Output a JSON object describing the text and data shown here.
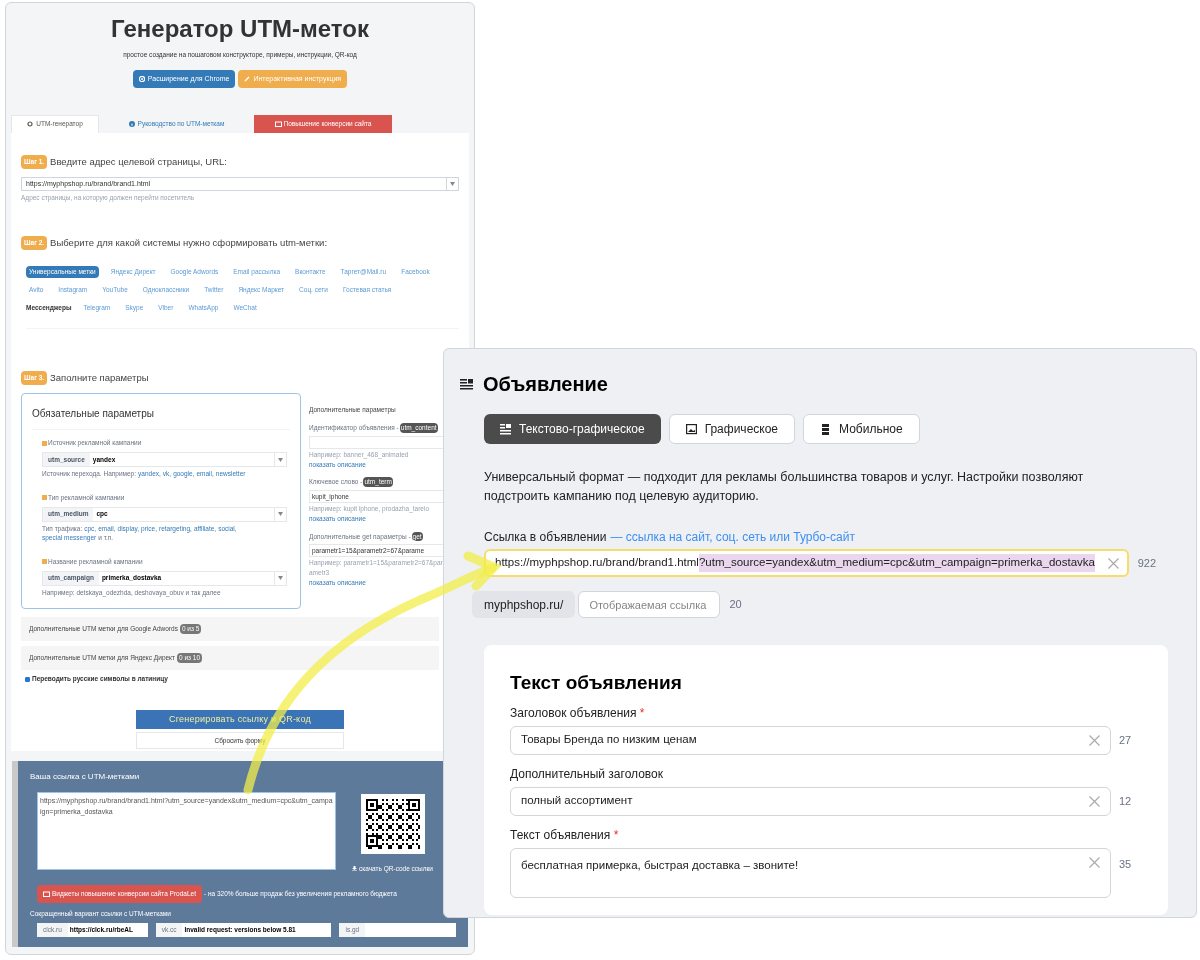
{
  "utm_page": {
    "title": "Генератор UTM-меток",
    "subtitle": "простое создание на пошаговом конструкторе, примеры, инструкции, QR-код",
    "header_buttons": [
      {
        "label": "Расширение для Chrome",
        "kind": "chrome"
      },
      {
        "label": "Интерактивная инструкция",
        "kind": "guide"
      }
    ],
    "tabs": [
      {
        "label": "UTM-генератор",
        "selected": true,
        "kind": "generator"
      },
      {
        "label": "Руководство по UTM-меткам",
        "selected": false,
        "kind": "guide"
      },
      {
        "label": "Повышение конверсии сайта",
        "selected": false,
        "kind": "promo"
      }
    ],
    "step1": {
      "badge": "Шаг 1.",
      "title": "Введите адрес целевой страницы, URL:",
      "value": "https://myphpshop.ru/brand/brand1.html",
      "hint": "Адрес страницы, на которую должен перейти посетитель"
    },
    "step2": {
      "badge": "Шаг 2.",
      "title": "Выберите для какой системы нужно сформировать utm-метки:",
      "rows": [
        {
          "systems": [
            {
              "label": "Универсальные метки",
              "kind": "system",
              "selected": true
            },
            {
              "label": "Яндекс Директ",
              "kind": "system",
              "selected": false
            },
            {
              "label": "Google Adwords",
              "kind": "system",
              "selected": false
            },
            {
              "label": "Email рассылка",
              "kind": "system",
              "selected": false
            },
            {
              "label": "Вконтакте",
              "kind": "system",
              "selected": false
            },
            {
              "label": "Таргет@Mail.ru",
              "kind": "system",
              "selected": false
            },
            {
              "label": "Facebook",
              "kind": "system",
              "selected": false
            }
          ]
        },
        {
          "systems": [
            {
              "label": "Avito",
              "kind": "system",
              "selected": false
            },
            {
              "label": "Instagram",
              "kind": "system",
              "selected": false
            },
            {
              "label": "YouTube",
              "kind": "system",
              "selected": false
            },
            {
              "label": "Одноклассники",
              "kind": "system",
              "selected": false
            },
            {
              "label": "Twitter",
              "kind": "system",
              "selected": false
            },
            {
              "label": "Яндекс Маркет",
              "kind": "system",
              "selected": false
            },
            {
              "label": "Соц. сети",
              "kind": "system",
              "selected": false
            },
            {
              "label": "Гостевая статья",
              "kind": "system",
              "selected": false
            }
          ]
        },
        {
          "label": "Мессенджеры",
          "systems": [
            {
              "label": "Telegram",
              "kind": "system",
              "selected": false
            },
            {
              "label": "Skype",
              "kind": "system",
              "selected": false
            },
            {
              "label": "Viber",
              "kind": "system",
              "selected": false
            },
            {
              "label": "WhatsApp",
              "kind": "system",
              "selected": false
            },
            {
              "label": "WeChat",
              "kind": "system",
              "selected": false
            }
          ]
        }
      ]
    },
    "step3": {
      "badge": "Шаг 3.",
      "title": "Заполните параметры",
      "required": {
        "title": "Обязательные параметры",
        "fields": [
          {
            "label": "Источник рекламной кампании",
            "addon": "utm_source",
            "value": "yandex",
            "help": "Источник перехода. Например:",
            "examples": [
              "yandex,",
              "vk,",
              "google,",
              "email,",
              "newsletter"
            ]
          },
          {
            "label": "Тип рекламной кампании",
            "addon": "utm_medium",
            "value": "cpc",
            "help": "Тип трафика:",
            "examples": [
              "cpc,",
              "email,",
              "display,",
              "price,",
              "retargeting,",
              "affiliate,",
              "social,",
              "special messenger"
            ],
            "suffix": "и т.п."
          },
          {
            "label": "Название рекламной кампании",
            "addon": "utm_campaign",
            "value": "primerka_dostavka",
            "help": "Например: detskaya_odezhda, deshovaya_obuv и так далее"
          }
        ]
      },
      "optional": {
        "title": "Дополнительные параметры",
        "fields": [
          {
            "label": "Идентификатор объявления -",
            "tag": "utm_content",
            "help": "Например: banner_468_animated",
            "link": "показать описание"
          },
          {
            "label": "Ключевое слово -",
            "tag": "utm_term",
            "value": "kupit_iphone",
            "help": "Например: kupit iphone, prodazha_tareio",
            "link": "показать описание"
          },
          {
            "label": "Дополнительные get параметры -",
            "tag": "get",
            "value": "parametr1=15&parametr2=67&parame",
            "help": "Например: parametr1=15&parametr2=67&parametr3",
            "link": "показать описание"
          }
        ]
      }
    },
    "accordions": [
      {
        "title": "Дополнительные UTM метки для Google Adwords",
        "count": "0 из 5"
      },
      {
        "title": "Дополнительные UTM метки для Яндекс Директ",
        "count": "0 из 10"
      }
    ],
    "transliterate": {
      "label": "Переводить русские символы в латиницу",
      "checked": true
    },
    "generate_button": "Сгенерировать ссылку и QR-код",
    "reset_button": "Сбросить форму",
    "result": {
      "title": "Ваша ссылка с UTM-метками",
      "link": "https://myphpshop.ru/brand/brand1.html?utm_source=yandex&utm_medium=cpc&utm_campaign=primerka_dostavka",
      "qr_download": "скачать QR-code ссылки",
      "promo_button": "Виджеты повышение конверсии сайта ProdaLet",
      "promo_text": "- на 320% больше продаж без увеличения рекламного бюджета",
      "short_title": "Сокращенный вариант ссылки с UTM-метками",
      "shorteners": [
        {
          "service": "clck.ru",
          "value": "https://clck.ru/rbeAL"
        },
        {
          "service": "vk.cc",
          "value": "Invalid request: versions below 5.81"
        },
        {
          "service": "is.gd"
        }
      ]
    }
  },
  "ad_panel": {
    "title": "Объявление",
    "formats": [
      {
        "label": "Текстово-графическое",
        "selected": true,
        "kind": "text-image"
      },
      {
        "label": "Графическое",
        "selected": false,
        "kind": "image"
      },
      {
        "label": "Мобильное",
        "selected": false,
        "kind": "mobile"
      }
    ],
    "description": "Универсальный формат — подходит для рекламы большинства товаров и услуг. Настройки позволяют подстроить кампанию под целевую аудиторию.",
    "link_label": "Ссылка в объявлении",
    "link_hint": "— ссылка на сайт, соц. сеть или Турбо-сайт",
    "link_value": "https://myphpshop.ru/brand/brand1.html",
    "link_selected": "?utm_source=yandex&utm_medium=cpc&utm_campaign=primerka_dostavka",
    "link_count": "922",
    "display_domain": "myphpshop.ru/",
    "display_placeholder": "Отображаемая ссылка",
    "display_count": "20",
    "text_section": {
      "title": "Текст объявления",
      "fields": [
        {
          "label": "Заголовок объявления",
          "asterisk": "*",
          "value": "Товары Бренда по низким ценам",
          "count": "27",
          "kind": "input"
        },
        {
          "label": "Дополнительный заголовок",
          "value": "полный ассортимент",
          "count": "12",
          "kind": "input"
        },
        {
          "label": "Текст объявления",
          "asterisk": "*",
          "value": "бесплатная примерка, быстрая доставка – звоните!",
          "count": "35",
          "kind": "textarea"
        }
      ]
    }
  }
}
